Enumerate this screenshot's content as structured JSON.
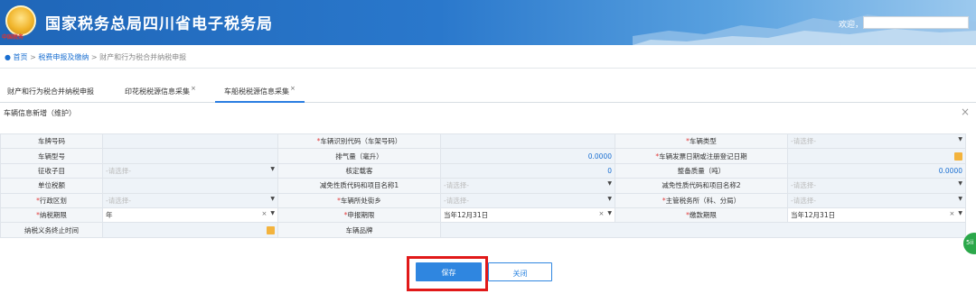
{
  "header": {
    "emblem_caption": "中国税务",
    "site_title": "国家税务总局四川省电子税务局",
    "welcome_text": "欢迎，",
    "user_name": ""
  },
  "breadcrumb": {
    "home": "首页",
    "sep": ">",
    "level1": "税费申报及缴纳",
    "level2": "财产和行为税合并纳税申报"
  },
  "tabs": [
    {
      "label": "财产和行为税合并纳税申报",
      "closable": false
    },
    {
      "label": "印花税税源信息采集",
      "closable": true
    },
    {
      "label": "车船税税源信息采集",
      "closable": true,
      "active": true
    }
  ],
  "close_mark": "×",
  "section_title": "车辆信息新增（维护）",
  "required_mark": "*",
  "form": {
    "rows": [
      [
        {
          "label": "车牌号码",
          "required": false,
          "value": "",
          "type": "text"
        },
        {
          "label": "车辆识别代码（车架号码）",
          "required": true,
          "value": "",
          "type": "text"
        },
        {
          "label": "车辆类型",
          "required": true,
          "value": "-请选择-",
          "type": "select"
        }
      ],
      [
        {
          "label": "车辆型号",
          "required": false,
          "value": "",
          "type": "text"
        },
        {
          "label": "排气量（毫升）",
          "required": false,
          "value": "0.0000",
          "type": "number"
        },
        {
          "label": "车辆发票日期或注册登记日期",
          "required": true,
          "value": "",
          "type": "date"
        }
      ],
      [
        {
          "label": "征收子目",
          "required": false,
          "value": "-请选择-",
          "type": "select"
        },
        {
          "label": "核定载客",
          "required": false,
          "value": "0",
          "type": "number"
        },
        {
          "label": "整备质量（吨）",
          "required": false,
          "value": "0.0000",
          "type": "number"
        }
      ],
      [
        {
          "label": "单位税额",
          "required": false,
          "value": "",
          "type": "text"
        },
        {
          "label": "减免性质代码和项目名称1",
          "required": false,
          "value": "-请选择-",
          "type": "select"
        },
        {
          "label": "减免性质代码和项目名称2",
          "required": false,
          "value": "-请选择-",
          "type": "select"
        }
      ],
      [
        {
          "label": "行政区划",
          "required": true,
          "value": "-请选择-",
          "type": "select"
        },
        {
          "label": "车辆所处街乡",
          "required": true,
          "value": "-请选择-",
          "type": "select"
        },
        {
          "label": "主管税务所（科、分局）",
          "required": true,
          "value": "-请选择-",
          "type": "select"
        }
      ],
      [
        {
          "label": "纳税期限",
          "required": true,
          "value": "年",
          "type": "select-clear"
        },
        {
          "label": "申报期限",
          "required": true,
          "value": "当年12月31日",
          "type": "select-clear"
        },
        {
          "label": "缴款期限",
          "required": true,
          "value": "当年12月31日",
          "type": "select-clear"
        }
      ],
      [
        {
          "label": "纳税义务终止时间",
          "required": false,
          "value": "",
          "type": "date"
        },
        {
          "label": "车辆品牌",
          "required": false,
          "value": "",
          "type": "text-wide"
        }
      ]
    ]
  },
  "buttons": {
    "save": "保存",
    "close": "关闭"
  },
  "side_badge": "5ii",
  "colors": {
    "header_blue": "#1f66b8",
    "primary_button": "#2f86e0",
    "required_red": "#e23b3b",
    "highlight_box": "#e11919",
    "calendar_icon": "#f3b33d"
  }
}
